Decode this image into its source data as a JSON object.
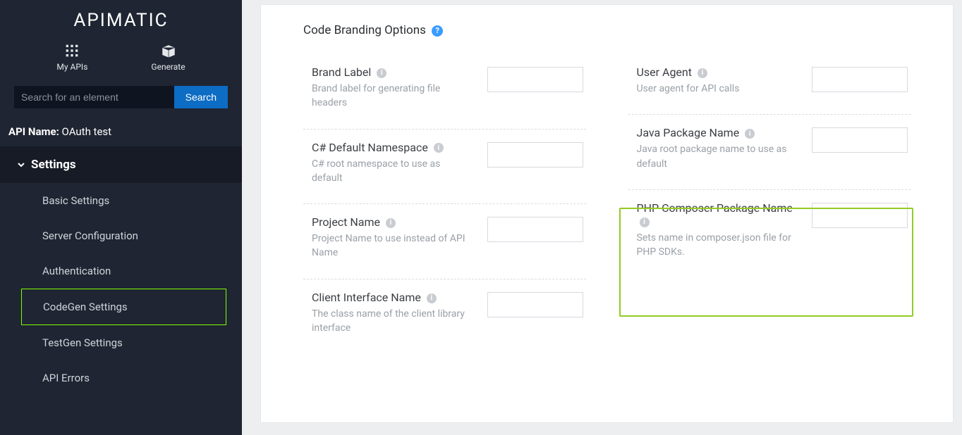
{
  "brand": "APIMATIC",
  "top": {
    "myapis": "My APIs",
    "generate": "Generate"
  },
  "search": {
    "placeholder": "Search for an element",
    "button": "Search"
  },
  "api_name_label": "API Name:",
  "api_name_value": "OAuth test",
  "section": "Settings",
  "nav": [
    "Basic Settings",
    "Server Configuration",
    "Authentication",
    "CodeGen Settings",
    "TestGen Settings",
    "API Errors"
  ],
  "panel": {
    "title": "Code Branding Options",
    "left": [
      {
        "label": "Brand Label",
        "desc": "Brand label for generating file headers"
      },
      {
        "label": "C# Default Namespace",
        "desc": "C# root namespace to use as default"
      },
      {
        "label": "Project Name",
        "desc": "Project Name to use instead of API Name"
      },
      {
        "label": "Client Interface Name",
        "desc": "The class name of the client library interface"
      }
    ],
    "right": [
      {
        "label": "User Agent",
        "desc": "User agent for API calls"
      },
      {
        "label": "Java Package Name",
        "desc": "Java root package name to use as default"
      },
      {
        "label": "PHP Composer Package Name",
        "desc": "Sets name in composer.json file for PHP SDKs."
      }
    ]
  }
}
